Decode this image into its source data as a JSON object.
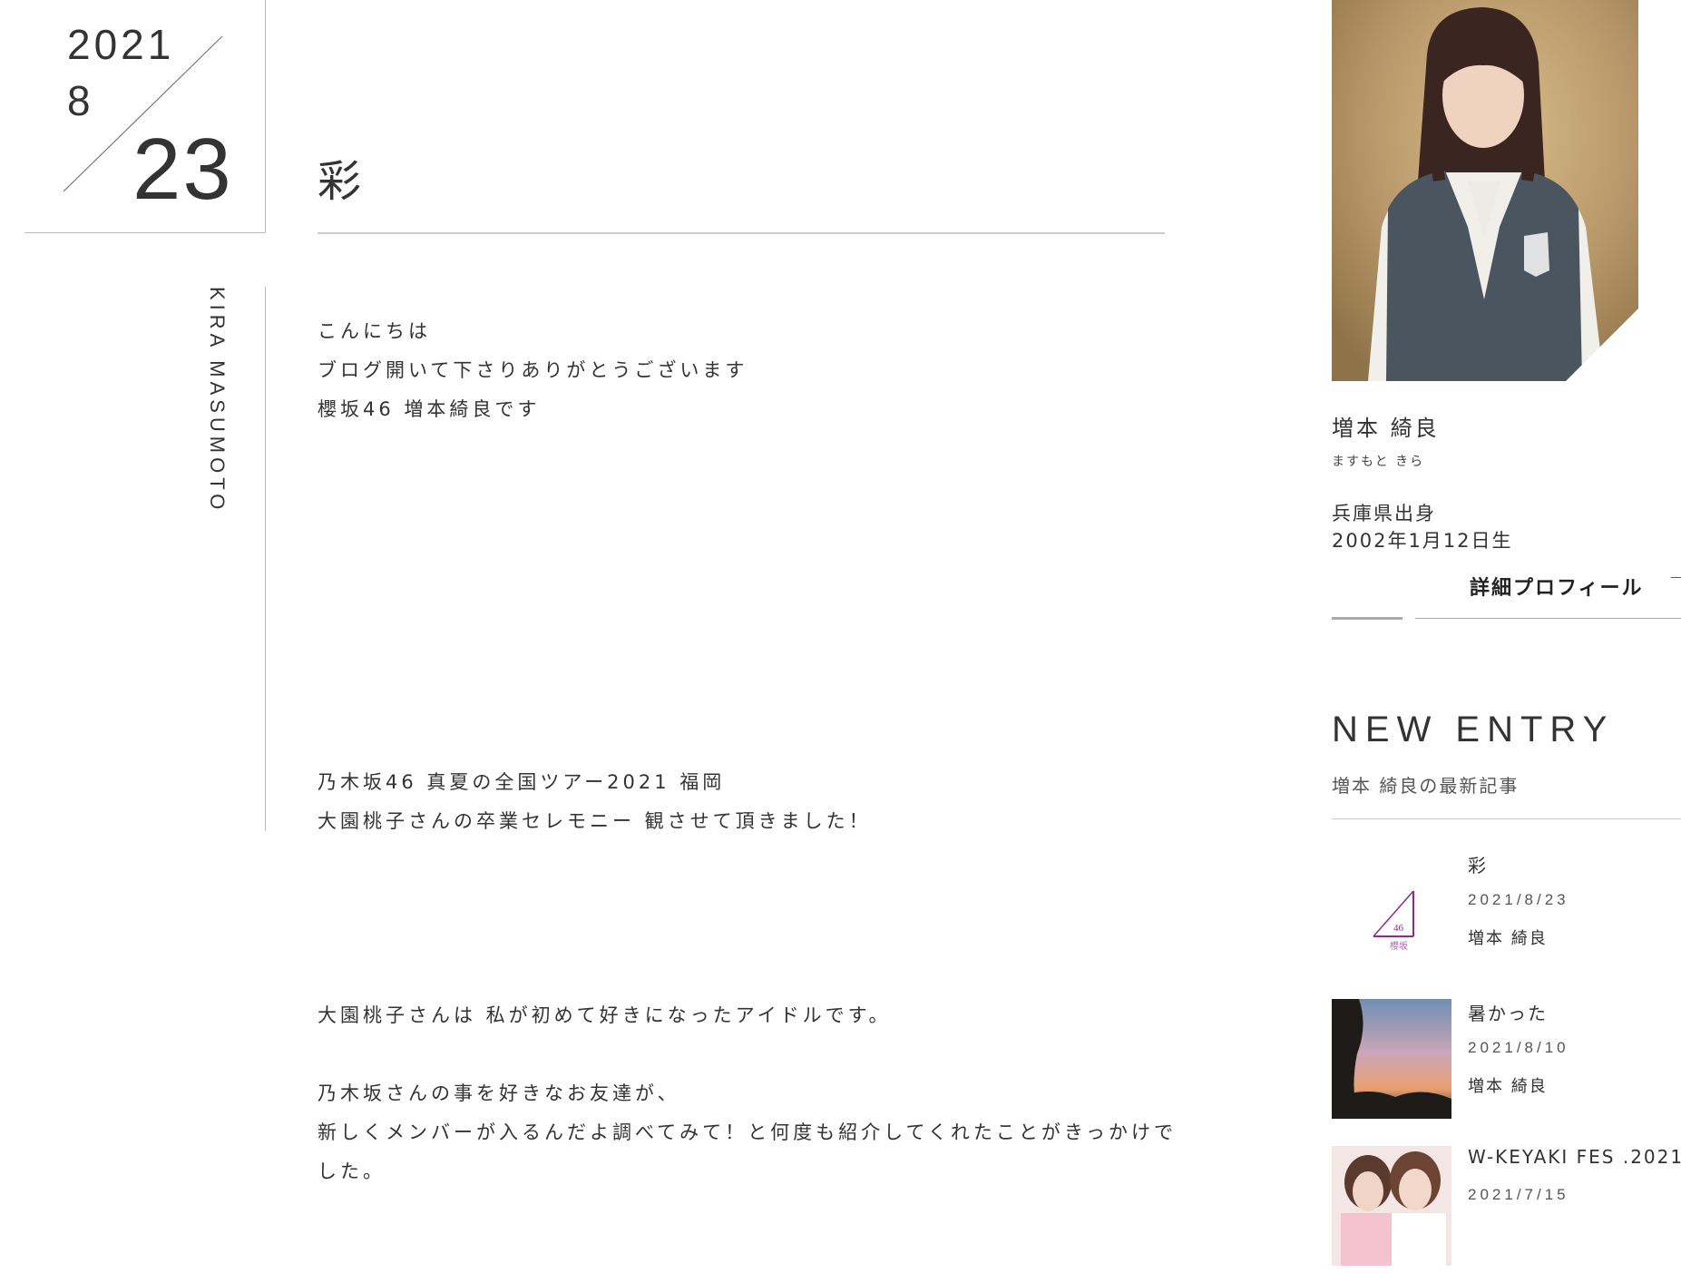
{
  "date": {
    "year": "2021",
    "month": "8",
    "day": "23"
  },
  "member_vertical": "KIRA MASUMOTO",
  "post": {
    "title": "彩",
    "body": [
      "こんにちは",
      "ブログ開いて下さりありがとうございます",
      "櫻坂46 増本綺良です",
      "乃木坂46 真夏の全国ツアー2021 福岡",
      "大園桃子さんの卒業セレモニー 観させて頂きました！",
      "大園桃子さんは 私が初めて好きになったアイドルです。",
      "乃木坂さんの事を好きなお友達が、",
      "新しくメンバーが入るんだよ調べてみて！と何度も紹介してくれたことがきっかけでした。"
    ]
  },
  "profile": {
    "name": "増本 綺良",
    "kana": "ますもと きら",
    "birthplace": "兵庫県出身",
    "birthday": "2002年1月12日生",
    "link_label": "詳細プロフィール",
    "accent_color": "#e08aa6"
  },
  "new_entry": {
    "title": "NEW ENTRY",
    "subtitle": "増本 綺良の最新記事",
    "items": [
      {
        "title": "彩",
        "date": "2021/8/23",
        "author": "増本 綺良",
        "thumb": "sakurazaka46-logo"
      },
      {
        "title": "暑かった",
        "date": "2021/8/10",
        "author": "増本 綺良",
        "thumb": "sunset-photo"
      },
      {
        "title": "W-KEYAKI FES .2021",
        "date": "2021/7/15",
        "author": "",
        "thumb": "members-photo"
      }
    ]
  },
  "logo": {
    "number": "46",
    "name": "櫻坂",
    "color": "#8e2a8e"
  }
}
